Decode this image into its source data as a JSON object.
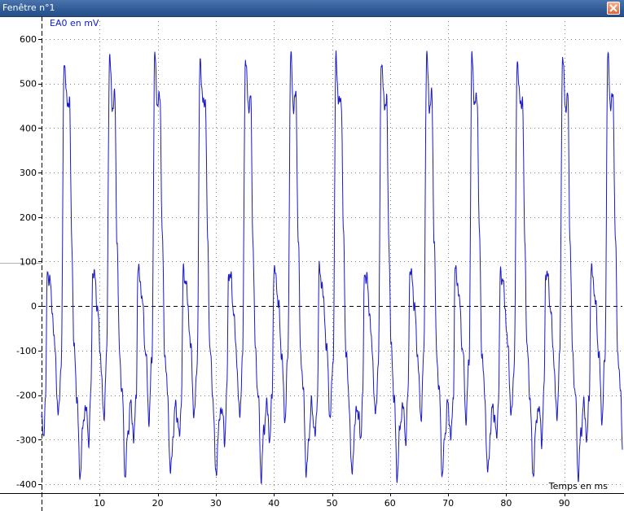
{
  "window": {
    "title": "Fenêtre n°1",
    "close_icon": "close-icon"
  },
  "chart_data": {
    "type": "line",
    "ylabel": "EA0 en mV",
    "xlabel": "Temps en ms",
    "xlim": [
      0,
      100
    ],
    "ylim": [
      -420,
      640
    ],
    "x_ticks": [
      10,
      20,
      30,
      40,
      50,
      60,
      70,
      80,
      90
    ],
    "y_ticks": [
      -400,
      -300,
      -200,
      -100,
      0,
      100,
      200,
      300,
      400,
      500,
      600
    ],
    "grid": true,
    "zero_line": "dashed",
    "colors": {
      "series": "#1a1ac8",
      "grid": "#808080",
      "axis": "#000000"
    },
    "series": [
      {
        "period_ms": 7.8,
        "waveform_x": [
          0,
          0.3,
          0.7,
          1.0,
          1.4,
          1.8,
          2.3,
          2.9,
          3.4,
          3.9,
          4.4,
          4.8,
          5.2,
          5.6,
          6.1,
          6.6,
          7.1,
          7.5,
          7.8
        ],
        "waveform_y": [
          -250,
          -300,
          -200,
          80,
          60,
          0,
          -100,
          -250,
          -120,
          560,
          450,
          470,
          150,
          -100,
          -200,
          -380,
          -280,
          -220,
          -250
        ]
      }
    ]
  }
}
